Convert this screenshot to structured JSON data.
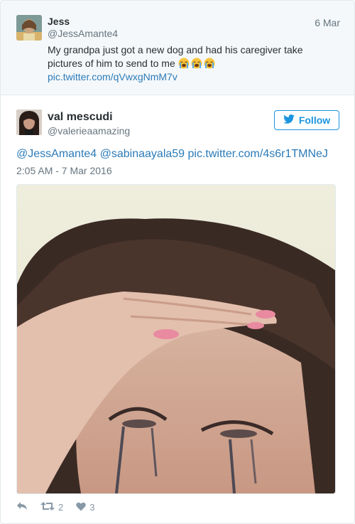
{
  "quoted_tweet": {
    "name": "Jess",
    "handle": "@JessAmante4",
    "date": "6 Mar",
    "text": "My grandpa just got a new dog and had his caregiver take pictures of him to send to me ",
    "emoji": [
      "loudly-crying-face",
      "loudly-crying-face",
      "loudly-crying-face"
    ],
    "link": "pic.twitter.com/qVwxgNmM7v"
  },
  "tweet": {
    "name": "val mescudi",
    "handle": "@valerieaamazing",
    "follow_label": "Follow",
    "text": "@JessAmante4 @sabinaayala59 pic.twitter.com/4s6r1TMNeJ",
    "timestamp": "2:05 AM - 7 Mar 2016",
    "photo": "crying-woman-photo",
    "retweet_count": "2",
    "like_count": "3"
  },
  "colors": {
    "link": "#2b7bb9",
    "accent": "#1b95e0",
    "muted": "#66757f",
    "action_icon": "#8899a6"
  }
}
